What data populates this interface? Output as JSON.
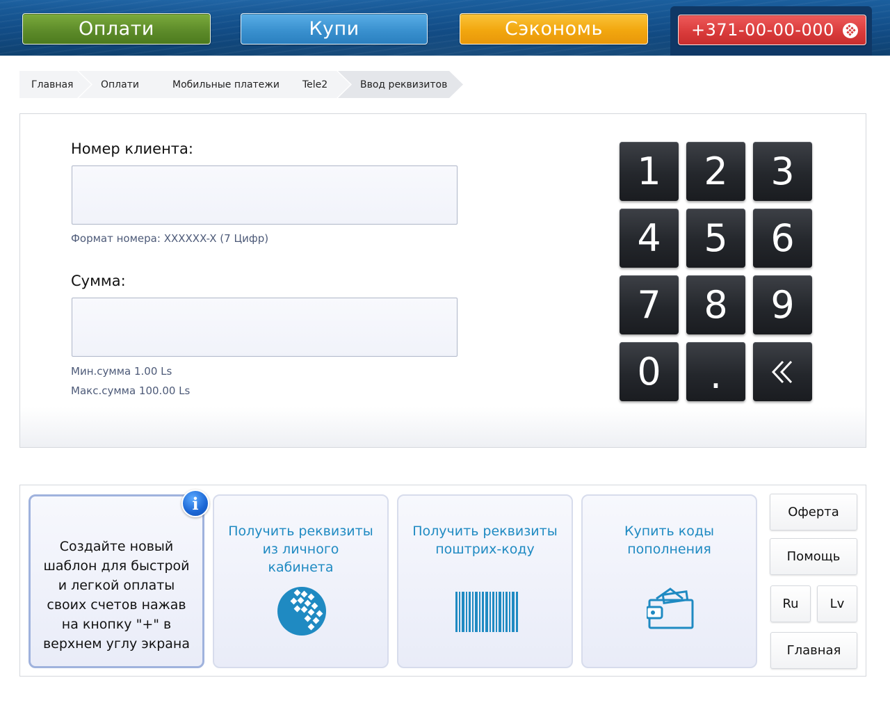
{
  "header": {
    "pay_label": "Оплати",
    "buy_label": "Купи",
    "save_label": "Сэкономь",
    "phone": "+371-00-00-000"
  },
  "breadcrumb": [
    "Главная",
    "Оплати",
    "Мобильные платежи",
    "Tele2",
    "Ввод реквизитов"
  ],
  "form": {
    "client_label": "Номер клиента:",
    "client_value": "",
    "client_hint": "Формат номера: XXXXXX-X (7 Цифр)",
    "sum_label": "Сумма:",
    "sum_value": "",
    "min_hint": "Мин.сумма 1.00 Ls",
    "max_hint": "Макс.сумма 100.00 Ls"
  },
  "keypad": [
    "1",
    "2",
    "3",
    "4",
    "5",
    "6",
    "7",
    "8",
    "9",
    "0",
    ".",
    "«"
  ],
  "tiles": {
    "template_text": "Создайте новый шаблон для быстрой и легкой оплаты своих счетов нажав на кнопку \"+\" в верхнем углу экрана",
    "info_badge": "i",
    "cabinet_text": "Получить реквизиты из личного кабинета",
    "barcode_text": "Получить реквизиты поштрих-коду",
    "codes_text": "Купить коды пополнения"
  },
  "side": {
    "offer": "Оферта",
    "help": "Помощь",
    "ru": "Ru",
    "lv": "Lv",
    "home": "Главная"
  },
  "colors": {
    "pay": "#5e8c2a",
    "buy": "#3a91cf",
    "save": "#f2a70f",
    "phone": "#d83a3a",
    "tile_text": "#1f8ac2"
  },
  "icons": {
    "webmoney": "webmoney-globe-icon",
    "barcode": "barcode-icon",
    "wallet": "wallet-icon",
    "backspace": "double-chevron-left-icon"
  }
}
